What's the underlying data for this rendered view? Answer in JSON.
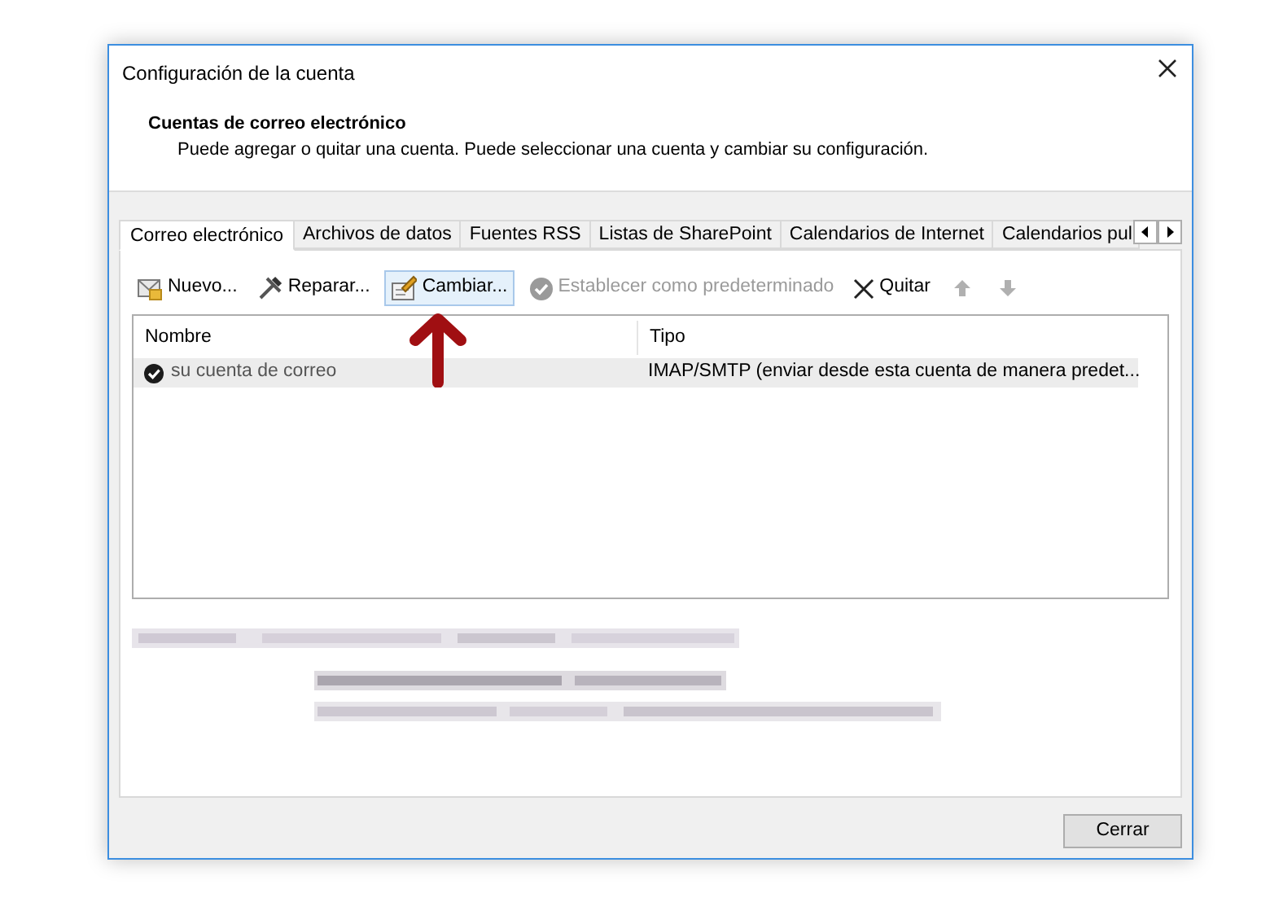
{
  "window": {
    "title": "Configuración de la cuenta"
  },
  "header": {
    "heading": "Cuentas de correo electrónico",
    "description": "Puede agregar o quitar una cuenta. Puede seleccionar una cuenta y cambiar su configuración."
  },
  "tabs": [
    {
      "label": "Correo electrónico",
      "selected": true
    },
    {
      "label": "Archivos de datos",
      "selected": false
    },
    {
      "label": "Fuentes RSS",
      "selected": false
    },
    {
      "label": "Listas de SharePoint",
      "selected": false
    },
    {
      "label": "Calendarios de Internet",
      "selected": false
    },
    {
      "label": "Calendarios pul",
      "selected": false
    }
  ],
  "toolbar": [
    {
      "kind": "new",
      "label": "Nuevo...",
      "disabled": false,
      "highlighted": false
    },
    {
      "kind": "repair",
      "label": "Reparar...",
      "disabled": false,
      "highlighted": false
    },
    {
      "kind": "change",
      "label": "Cambiar...",
      "disabled": false,
      "highlighted": true
    },
    {
      "kind": "default",
      "label": "Establecer como predeterminado",
      "disabled": true,
      "highlighted": false
    },
    {
      "kind": "remove",
      "label": "Quitar",
      "disabled": false,
      "highlighted": false
    },
    {
      "kind": "up",
      "disabled": true,
      "highlighted": false
    },
    {
      "kind": "down",
      "disabled": true,
      "highlighted": false
    }
  ],
  "table": {
    "columns": [
      "Nombre",
      "Tipo"
    ],
    "rows": [
      {
        "cells": [
          "su cuenta de correo",
          "IMAP/SMTP (enviar desde esta cuenta de manera predet..."
        ],
        "selected": true,
        "default": true
      }
    ]
  },
  "buttons": [
    "Cerrar"
  ]
}
